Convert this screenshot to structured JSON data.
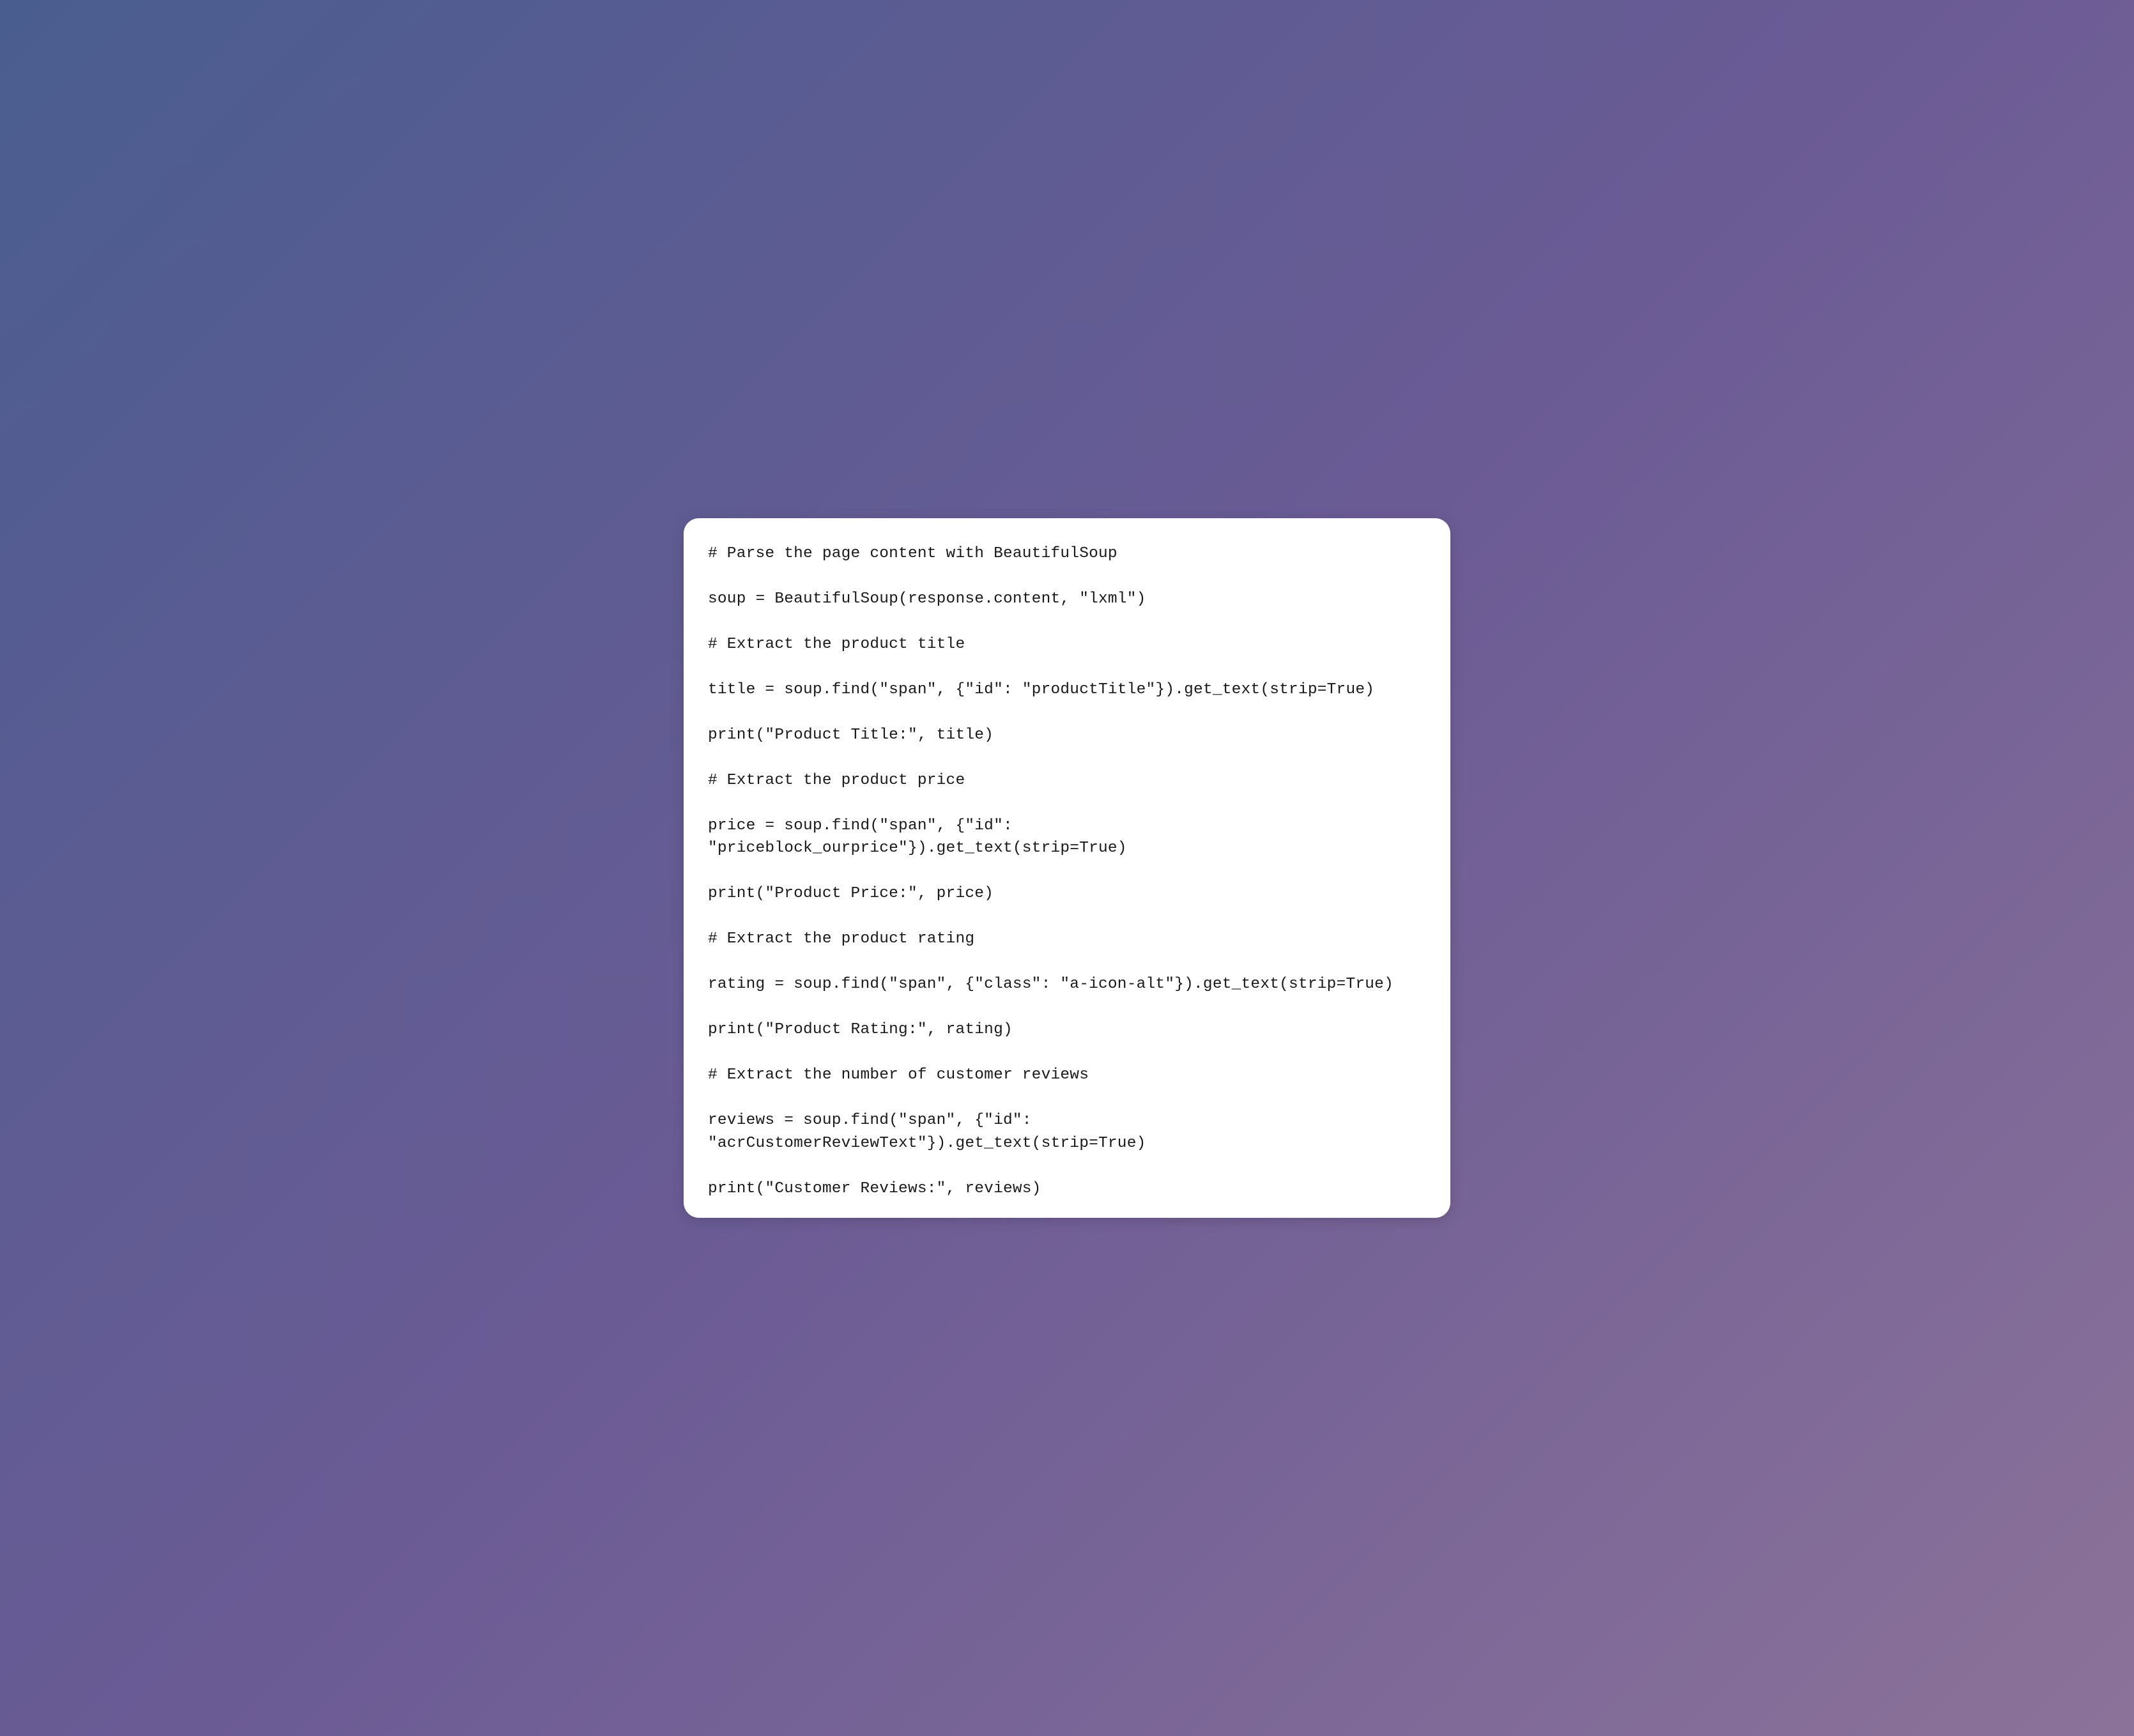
{
  "code": {
    "lines": [
      "# Parse the page content with BeautifulSoup",
      "",
      "soup = BeautifulSoup(response.content, \"lxml\")",
      "",
      "# Extract the product title",
      "",
      "title = soup.find(\"span\", {\"id\": \"productTitle\"}).get_text(strip=True)",
      "",
      "print(\"Product Title:\", title)",
      "",
      "# Extract the product price",
      "",
      "price = soup.find(\"span\", {\"id\": \"priceblock_ourprice\"}).get_text(strip=True)",
      "",
      "print(\"Product Price:\", price)",
      "",
      "# Extract the product rating",
      "",
      "rating = soup.find(\"span\", {\"class\": \"a-icon-alt\"}).get_text(strip=True)",
      "",
      "print(\"Product Rating:\", rating)",
      "",
      "# Extract the number of customer reviews",
      "",
      "reviews = soup.find(\"span\", {\"id\": \"acrCustomerReviewText\"}).get_text(strip=True)",
      "",
      "print(\"Customer Reviews:\", reviews)"
    ]
  }
}
